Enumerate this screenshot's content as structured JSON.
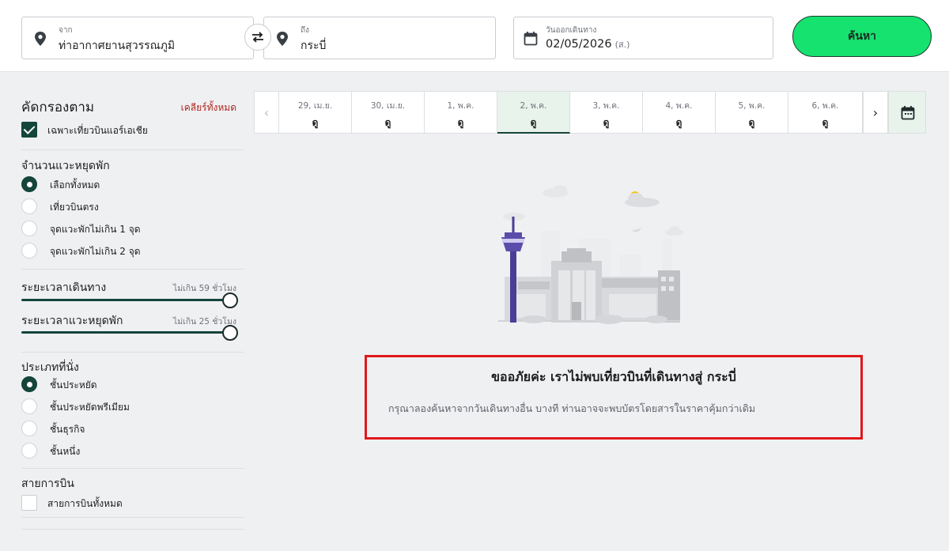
{
  "search": {
    "from_label": "จาก",
    "from_value": "ท่าอากาศยานสุวรรณภูมิ",
    "to_label": "ถึง",
    "to_value": "กระบี่",
    "date_label": "วันออกเดินทาง",
    "date_value": "02/05/2026",
    "date_dow": "(ส.)",
    "search_button": "ค้นหา"
  },
  "filters": {
    "title": "คัดกรองตาม",
    "clear_all": "เคลียร์ทั้งหมด",
    "airasia_only": "เฉพาะเที่ยวบินแอร์เอเชีย",
    "stops": {
      "title": "จำนวนแวะหยุดพัก",
      "options": [
        "เลือกทั้งหมด",
        "เที่ยวบินตรง",
        "จุดแวะพักไม่เกิน 1 จุด",
        "จุดแวะพักไม่เกิน 2 จุด"
      ],
      "selected": 0
    },
    "travel_time": {
      "title": "ระยะเวลาเดินทาง",
      "limit": "ไม่เกิน 59 ชั่วโมง",
      "level": 1.0
    },
    "layover_time": {
      "title": "ระยะเวลาแวะหยุดพัก",
      "limit": "ไม่เกิน 25 ชั่วโมง",
      "level": 1.0
    },
    "cabin": {
      "title": "ประเภทที่นั่ง",
      "options": [
        "ชั้นประหยัด",
        "ชั้นประหยัดพรีเมียม",
        "ชั้นธุรกิจ",
        "ชั้นหนึ่ง"
      ],
      "selected": 0
    },
    "airlines": {
      "title": "สายการบิน",
      "all": "สายการบินทั้งหมด"
    }
  },
  "date_strip": {
    "dates": [
      {
        "date": "29, เม.ย.",
        "value": "ดู"
      },
      {
        "date": "30, เม.ย.",
        "value": "ดู"
      },
      {
        "date": "1, พ.ค.",
        "value": "ดู"
      },
      {
        "date": "2, พ.ค.",
        "value": "ดู"
      },
      {
        "date": "3, พ.ค.",
        "value": "ดู"
      },
      {
        "date": "4, พ.ค.",
        "value": "ดู"
      },
      {
        "date": "5, พ.ค.",
        "value": "ดู"
      },
      {
        "date": "6, พ.ค.",
        "value": "ดู"
      }
    ],
    "selected": 3
  },
  "empty_state": {
    "title": "ขออภัยค่ะ เราไม่พบเที่ยวบินที่เดินทางสู่ กระบี่",
    "subtitle": "กรุณาลองค้นหาจากวันเดินทางอื่น บางที ท่านอาจจะพบบัตรโดยสารในราคาคุ้มกว่าเดิม"
  },
  "colors": {
    "accent_green": "#15e26f",
    "dark_green": "#14453b",
    "clear_red": "#b0271f",
    "highlight_red": "#e0181b"
  }
}
